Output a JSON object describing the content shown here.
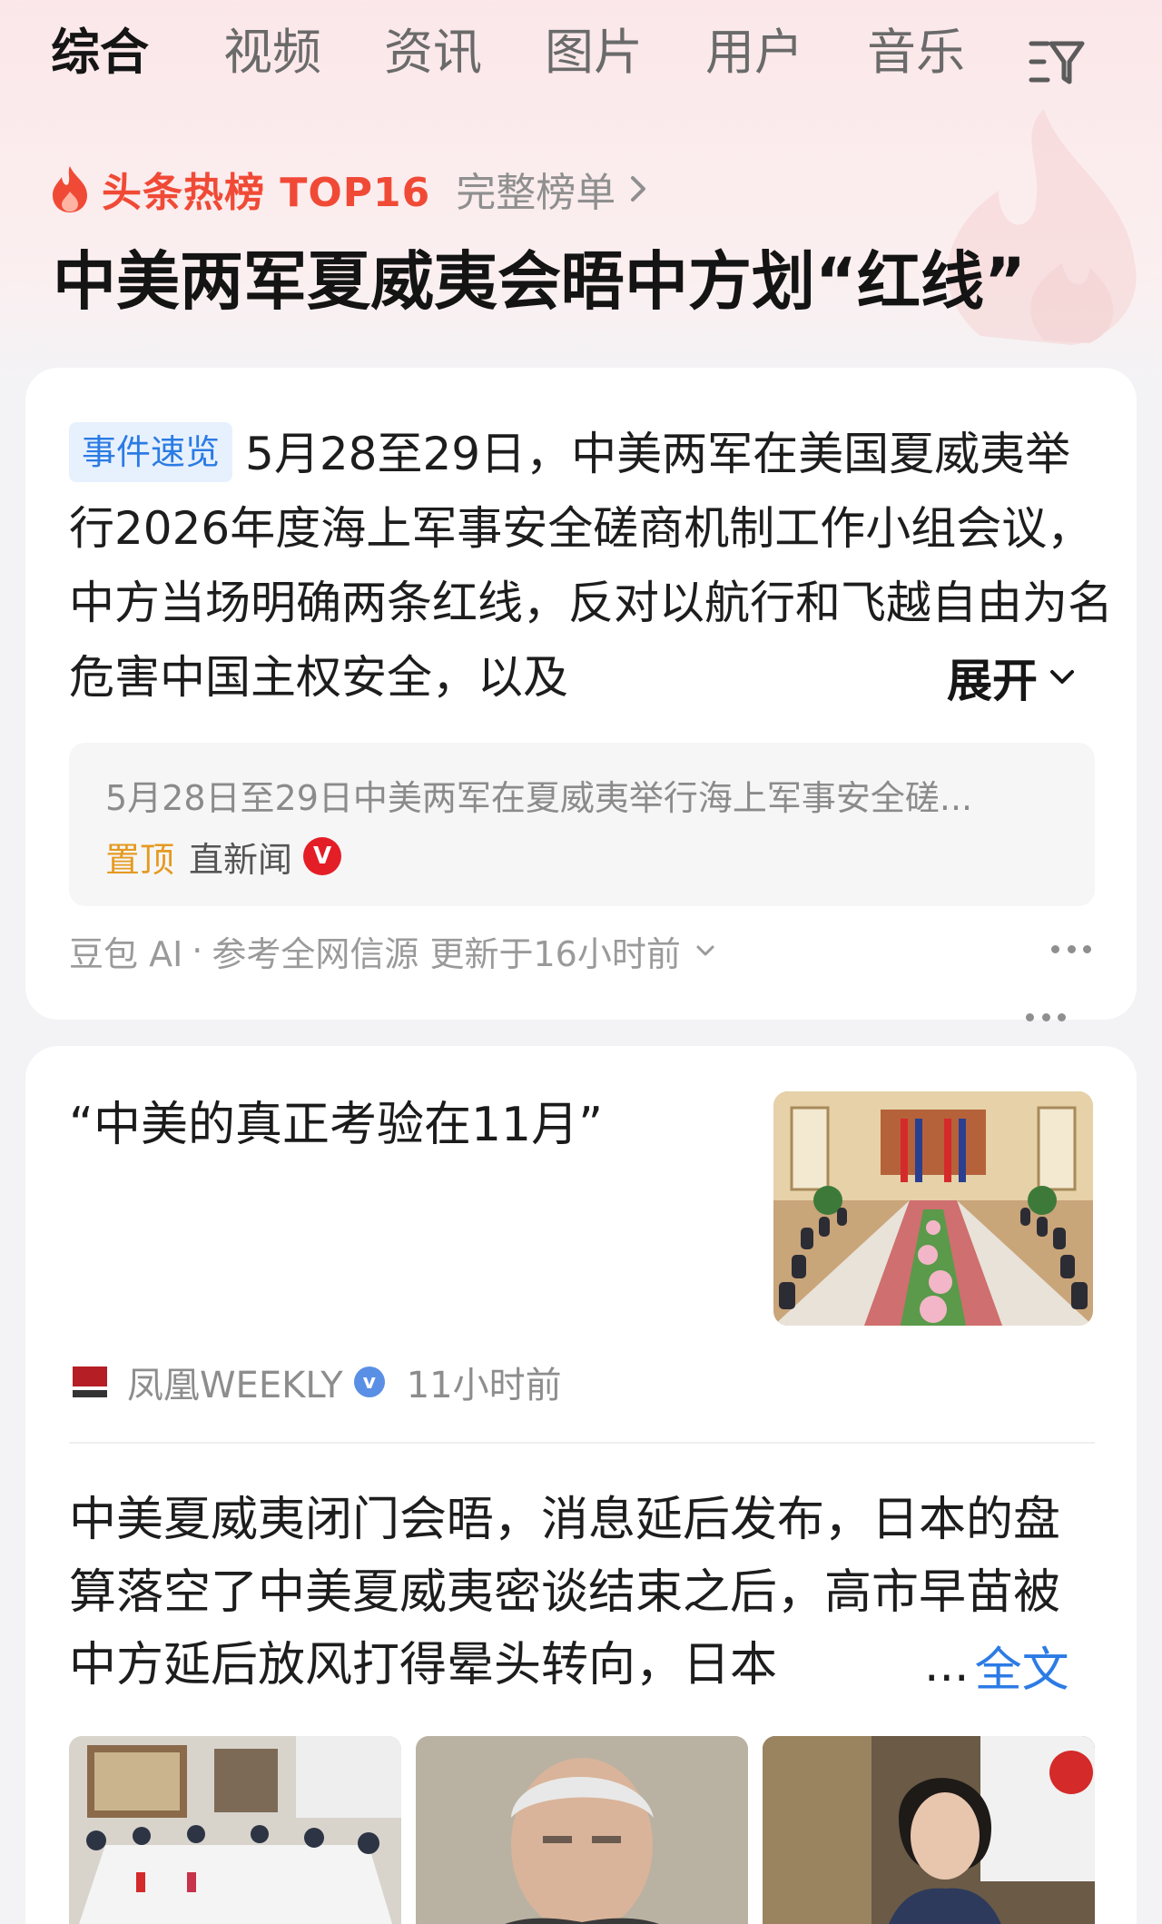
{
  "tabs": [
    "综合",
    "视频",
    "资讯",
    "图片",
    "用户",
    "音乐"
  ],
  "hot": {
    "label": "头条热榜 TOP16",
    "full_list": "完整榜单",
    "headline": "中美两军夏威夷会晤中方划“红线”"
  },
  "summary_card": {
    "tag": "事件速览",
    "text": "5月28至29日，中美两军在美国夏威夷举行2026年度海上军事安全磋商机制工作小组会议，中方当场明确两条红线，反对以航行和飞越自由为名危害中国主权安全，以及",
    "expand": "展开",
    "source_title": "5月28日至29日中美两军在夏威夷举行海上军事安全磋...",
    "source_pin": "置顶",
    "source_name": "直新闻",
    "source_badge": "V",
    "ai_name": "豆包 AI",
    "ai_dot": "·",
    "ai_ref": "参考全网信源 更新于16小时前"
  },
  "article1": {
    "title": "“中美的真正考验在11月”",
    "publisher": "凤凰WEEKLY",
    "badge": "v",
    "time": "11小时前"
  },
  "article2": {
    "text": "中美夏威夷闭门会晤，消息延后发布，日本的盘算落空了中美夏威夷密谈结束之后，高市早苗被中方延后放风打得晕头转向，日本",
    "ellipsis": "...",
    "full_text": "全文"
  },
  "colors": {
    "accent_red": "#f04a36",
    "link_blue": "#2c7be5",
    "tag_blue": "#2b7be4",
    "pin_orange": "#e59a22"
  }
}
